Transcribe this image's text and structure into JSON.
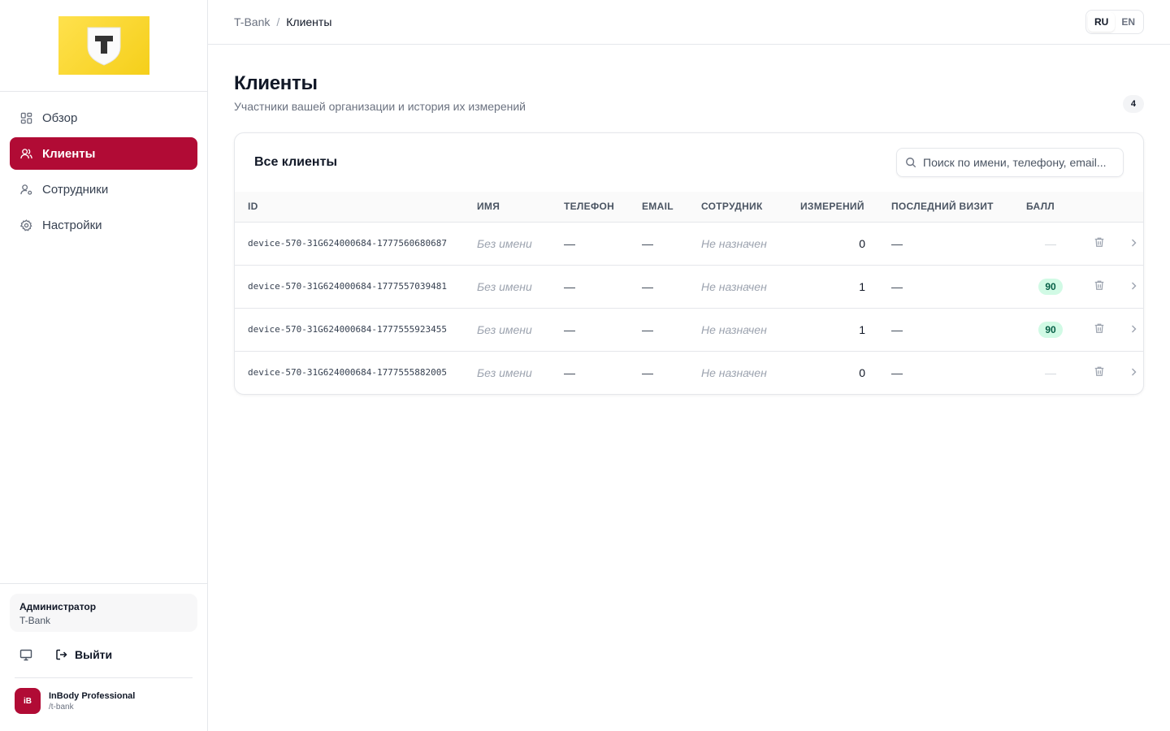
{
  "sidebar": {
    "nav": [
      {
        "label": "Обзор",
        "icon": "grid-icon"
      },
      {
        "label": "Клиенты",
        "icon": "users-icon",
        "active": true
      },
      {
        "label": "Сотрудники",
        "icon": "user-cog-icon"
      },
      {
        "label": "Настройки",
        "icon": "gear-icon"
      }
    ],
    "user": {
      "role": "Администратор",
      "org": "T-Bank"
    },
    "logout_label": "Выйти",
    "brand": {
      "badge": "iB",
      "name": "InBody Professional",
      "slug": "/t-bank"
    }
  },
  "header": {
    "breadcrumb_root": "T-Bank",
    "breadcrumb_sep": "/",
    "breadcrumb_current": "Клиенты",
    "lang": [
      "RU",
      "EN"
    ],
    "lang_active": "RU"
  },
  "page": {
    "title": "Клиенты",
    "subtitle": "Участники вашей организации и история их измерений",
    "count": "4"
  },
  "card": {
    "title": "Все клиенты",
    "search_placeholder": "Поиск по имени, телефону, email..."
  },
  "table": {
    "columns": [
      "ID",
      "ИМЯ",
      "ТЕЛЕФОН",
      "EMAIL",
      "СОТРУДНИК",
      "ИЗМЕРЕНИЙ",
      "ПОСЛЕДНИЙ ВИЗИТ",
      "БАЛЛ"
    ],
    "rows": [
      {
        "id": "device-570-31G624000684-1777560680687",
        "name": "Без имени",
        "phone": "—",
        "email": "—",
        "employee": "Не назначен",
        "measurements": "0",
        "last_visit": "—",
        "score": "—"
      },
      {
        "id": "device-570-31G624000684-1777557039481",
        "name": "Без имени",
        "phone": "—",
        "email": "—",
        "employee": "Не назначен",
        "measurements": "1",
        "last_visit": "—",
        "score": "90"
      },
      {
        "id": "device-570-31G624000684-1777555923455",
        "name": "Без имени",
        "phone": "—",
        "email": "—",
        "employee": "Не назначен",
        "measurements": "1",
        "last_visit": "—",
        "score": "90"
      },
      {
        "id": "device-570-31G624000684-1777555882005",
        "name": "Без имени",
        "phone": "—",
        "email": "—",
        "employee": "Не назначен",
        "measurements": "0",
        "last_visit": "—",
        "score": "—"
      }
    ]
  },
  "colors": {
    "accent": "#b10b35",
    "logo_yellow": "#ffdd2d",
    "score_bg": "#d1fae5",
    "score_fg": "#065f46"
  }
}
